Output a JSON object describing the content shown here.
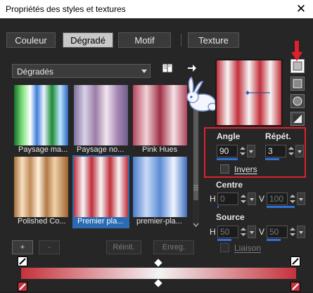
{
  "window": {
    "title": "Propriétés des styles et textures",
    "close_glyph": "✕"
  },
  "tabs": [
    {
      "label": "Couleur"
    },
    {
      "label": "Dégradé"
    },
    {
      "label": "Motif"
    },
    {
      "label": "Texture"
    }
  ],
  "category": {
    "selected": "Dégradés"
  },
  "gradients": [
    {
      "label": "Paysage ma..."
    },
    {
      "label": "Paysage no..."
    },
    {
      "label": "Pink Hues"
    },
    {
      "label": "Polished Co..."
    },
    {
      "label": "Premier pla..."
    },
    {
      "label": "premier-pla..."
    }
  ],
  "properties": {
    "angle_label": "Angle",
    "repeat_label": "Répét.",
    "angle_value": "90",
    "repeat_value": "3",
    "invert_label": "Invers",
    "center_label": "Centre",
    "center_h_label": "H",
    "center_v_label": "V",
    "center_h_value": "0",
    "center_v_value": "100",
    "source_label": "Source",
    "source_h_label": "H",
    "source_v_label": "V",
    "source_h_value": "50",
    "source_v_value": "50",
    "link_label": "Liaison"
  },
  "buttons": {
    "add": "+",
    "remove": "-",
    "reset": "Réinit.",
    "save": "Enreg."
  },
  "colors": {
    "accent": "#2f6fd6",
    "highlight_box": "#e0202a",
    "gradient_red": "#c5323c",
    "gradient_white": "#f3f3f3"
  }
}
